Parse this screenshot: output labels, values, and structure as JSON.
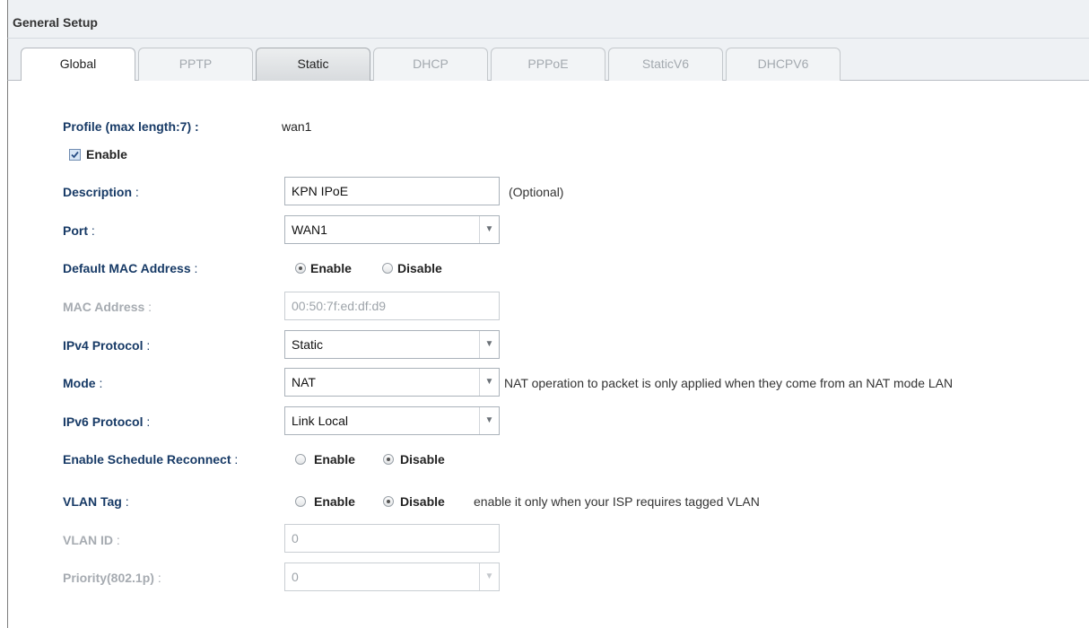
{
  "header": {
    "title": "General Setup"
  },
  "tabs": [
    "Global",
    "PPTP",
    "Static",
    "DHCP",
    "PPPoE",
    "StaticV6",
    "DHCPV6"
  ],
  "form": {
    "profile": {
      "label": "Profile (max length:7) :",
      "value": "wan1"
    },
    "enable_checkbox": {
      "label": "Enable",
      "checked": true
    },
    "description": {
      "label": "Description",
      "sep": " :",
      "value": "KPN IPoE",
      "note": "(Optional)"
    },
    "port": {
      "label": "Port",
      "sep": " :",
      "value": "WAN1"
    },
    "default_mac": {
      "label": "Default MAC Address",
      "sep": " :",
      "options": [
        "Enable",
        "Disable"
      ],
      "selected": "Enable"
    },
    "mac_address": {
      "label": "MAC Address",
      "sep": " :",
      "value": "00:50:7f:ed:df:d9"
    },
    "ipv4_protocol": {
      "label": "IPv4 Protocol",
      "sep": " :",
      "value": "Static"
    },
    "mode": {
      "label": "Mode",
      "sep": " :",
      "value": "NAT",
      "note": "NAT operation to packet is only applied when they come from an NAT mode LAN"
    },
    "ipv6_protocol": {
      "label": "IPv6 Protocol",
      "sep": " :",
      "value": "Link Local"
    },
    "schedule_reconnect": {
      "label": "Enable Schedule Reconnect",
      "sep": " :",
      "options": [
        "Enable",
        "Disable"
      ],
      "selected": "Disable"
    },
    "vlan_tag": {
      "label": "VLAN Tag",
      "sep": " :",
      "options": [
        "Enable",
        "Disable"
      ],
      "selected": "Disable",
      "note": "enable it only when your ISP requires tagged VLAN"
    },
    "vlan_id": {
      "label": "VLAN ID",
      "sep": " :",
      "value": "0"
    },
    "priority": {
      "label": "Priority(802.1p)",
      "sep": " :",
      "value": "0"
    }
  },
  "icons": {
    "dropdown": "chevron-down-icon",
    "checkbox": "checkmark-icon"
  },
  "colors": {
    "label_blue": "#173a66",
    "disabled_gray": "#a6abb1",
    "header_bg": "#eef1f4"
  }
}
